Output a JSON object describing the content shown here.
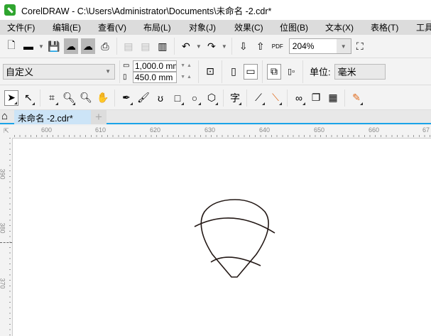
{
  "title": "CorelDRAW - C:\\Users\\Administrator\\Documents\\未命名 -2.cdr*",
  "menu": [
    "文件(F)",
    "编辑(E)",
    "查看(V)",
    "布局(L)",
    "对象(J)",
    "效果(C)",
    "位图(B)",
    "文本(X)",
    "表格(T)",
    "工具"
  ],
  "toolbar": {
    "zoom": "204%"
  },
  "property_bar": {
    "preset": "自定义",
    "width": "1,000.0 mm",
    "height": "450.0 mm",
    "units_label": "单位:",
    "units": "毫米"
  },
  "tabs": {
    "doc": "未命名 -2.cdr*",
    "add": "+"
  },
  "ruler": {
    "h": [
      "600",
      "610",
      "620",
      "630",
      "640",
      "650",
      "660",
      "67"
    ],
    "v": [
      "390",
      "380",
      "370"
    ]
  },
  "colors": {
    "accent": "#1aa3e8",
    "tab": "#cce4f7"
  }
}
